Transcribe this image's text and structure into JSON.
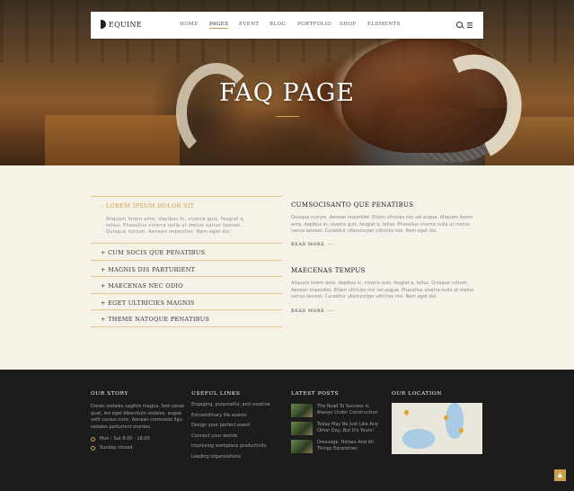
{
  "nav": {
    "logo": "EQUINE",
    "items": [
      "HOME",
      "PAGES",
      "EVENT",
      "BLOG",
      "PORTFOLIO",
      "SHOP",
      "ELEMENTS"
    ],
    "active_index": 1
  },
  "hero": {
    "title": "FAQ PAGE"
  },
  "accordion": [
    {
      "label": "– LOREM IPSUM DOLOR SIT",
      "body": "Aliquam lorem ante, dapibus in, viverra quis, feugiat a, tellus. Phasellus viverra nulla ut metus varius laoreet. Quisque rutrum. Aenean imperdiet. Nam eget dui."
    },
    {
      "label": "+ CUM SOCIS QUE PENATIBUS"
    },
    {
      "label": "+ MAGNIS DIS PARTURIENT"
    },
    {
      "label": "+ MAECENAS NEC ODIO"
    },
    {
      "label": "+ EGET ULTRICIES MAGNIS"
    },
    {
      "label": "+ THEME NATOQUE PENATIBUS"
    }
  ],
  "posts": [
    {
      "title": "CUMSOCISANTO QUE PENATIBUS",
      "text": "Quisque rutrum. Aenean imperdiet. Etiam ultricies nisi vel augue. Aliquam lorem ante, dapibus in, viverra quis, feugiat a, tellus. Phasellus viverra nulla ut metus varius laoreet. Curabitur ullamcorper ultricies nisi. Nam eget dui.",
      "link": "READ MORE"
    },
    {
      "title": "MAECENAS TEMPUS",
      "text": "Aliquam lorem ante, dapibus in, viverra quis, feugiat a, tellus. Quisque rutrum. Aenean imperdiet. Etiam ultricies nisi vel augue. Phasellus viverra nulla ut metus varius laoreet. Curabitur ullamcorper ultricies nisi. Nam eget dui.",
      "link": "READ MORE"
    }
  ],
  "footer": {
    "story": {
      "title": "OUR STORY",
      "text": "Donec sodales sagittis magna. Sed conse quat, leo eget bibendum sodales, augue velit cursus nunc. Aenean commodo ligu sodales parturient montes.",
      "hours": "Mon - Sat 8.00 - 18.00",
      "closed": "Sunday closed"
    },
    "links": {
      "title": "USEFUL LINKS",
      "items": [
        "Engaging, purposeful, and creative",
        "Extraordinary life events",
        "Design your perfect event",
        "Connect your worlds",
        "Improving workplace productivity",
        "Leading organizations"
      ]
    },
    "latest": {
      "title": "LATEST POSTS",
      "items": [
        "The Road To Success Is Always Under Construction",
        "Today May Be Just Like Any Other Day, But It's Yours!",
        "Dressage, Horses And All Things Equestrian"
      ]
    },
    "location": {
      "title": "OUR LOCATION"
    }
  },
  "colors": {
    "accent": "#c9a14a",
    "footer_bg": "#1c1c1c",
    "page_bg": "#f7f2e8"
  },
  "icons": {
    "search": "search-icon",
    "menu": "menu-icon",
    "clock": "clock-icon",
    "scroll_top": "chevron-up-icon"
  }
}
